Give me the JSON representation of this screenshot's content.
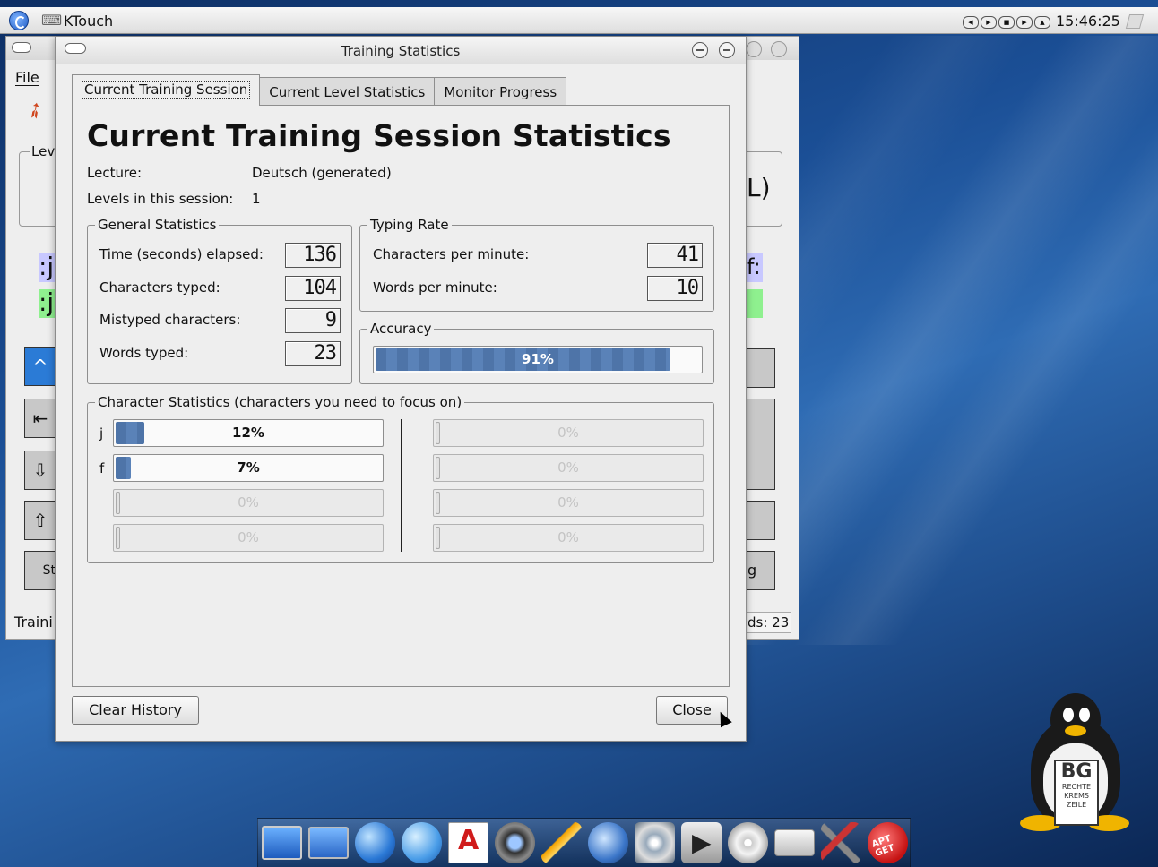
{
  "taskbar": {
    "window_title": "KTouch",
    "clock": "15:46:25"
  },
  "main_window": {
    "menu_file": "File",
    "level_label": "Lev",
    "paren_text": "L)",
    "line1_char": ":j",
    "line2_char": ":j",
    "line1_right": "f:",
    "status_left": "Traini",
    "status_right": "ds: 23",
    "key_st": "St",
    "key_g": "g"
  },
  "dialog": {
    "title": "Training Statistics",
    "tabs": [
      {
        "label": "Current Training Session"
      },
      {
        "label": "Current Level Statistics"
      },
      {
        "label": "Monitor Progress"
      }
    ],
    "heading": "Current Training Session Statistics",
    "lecture_label": "Lecture:",
    "lecture_value": "Deutsch (generated)",
    "levels_label": "Levels in this session:",
    "levels_value": "1",
    "general": {
      "title": "General Statistics",
      "rows": [
        {
          "label": "Time (seconds) elapsed:",
          "value": "136"
        },
        {
          "label": "Characters typed:",
          "value": "104"
        },
        {
          "label": "Mistyped characters:",
          "value": "9"
        },
        {
          "label": "Words typed:",
          "value": "23"
        }
      ]
    },
    "typing_rate": {
      "title": "Typing Rate",
      "rows": [
        {
          "label": "Characters per minute:",
          "value": "41"
        },
        {
          "label": "Words per minute:",
          "value": "10"
        }
      ]
    },
    "accuracy": {
      "title": "Accuracy",
      "value": 91,
      "text": "91%"
    },
    "char_stats": {
      "title": "Character Statistics (characters you need to focus on)",
      "left": [
        {
          "char": "j",
          "value": 12,
          "text": "12%"
        },
        {
          "char": "f",
          "value": 7,
          "text": "7%"
        },
        {
          "char": "",
          "value": 0,
          "text": "0%"
        },
        {
          "char": "",
          "value": 0,
          "text": "0%"
        }
      ],
      "right": [
        {
          "value": 0,
          "text": "0%"
        },
        {
          "value": 0,
          "text": "0%"
        },
        {
          "value": 0,
          "text": "0%"
        },
        {
          "value": 0,
          "text": "0%"
        }
      ]
    },
    "clear_history_label": "Clear History",
    "close_label": "Close"
  },
  "logo": {
    "sign_big": "BG",
    "sign_line1": "RECHTE",
    "sign_line2": "KREMS",
    "sign_line3": "ZEILE"
  },
  "dock_apt_label": "APT GET",
  "colors": {
    "progress_fill": "#4e74a8",
    "desktop": "#1b4f96",
    "window_bg": "#eeeeee"
  }
}
